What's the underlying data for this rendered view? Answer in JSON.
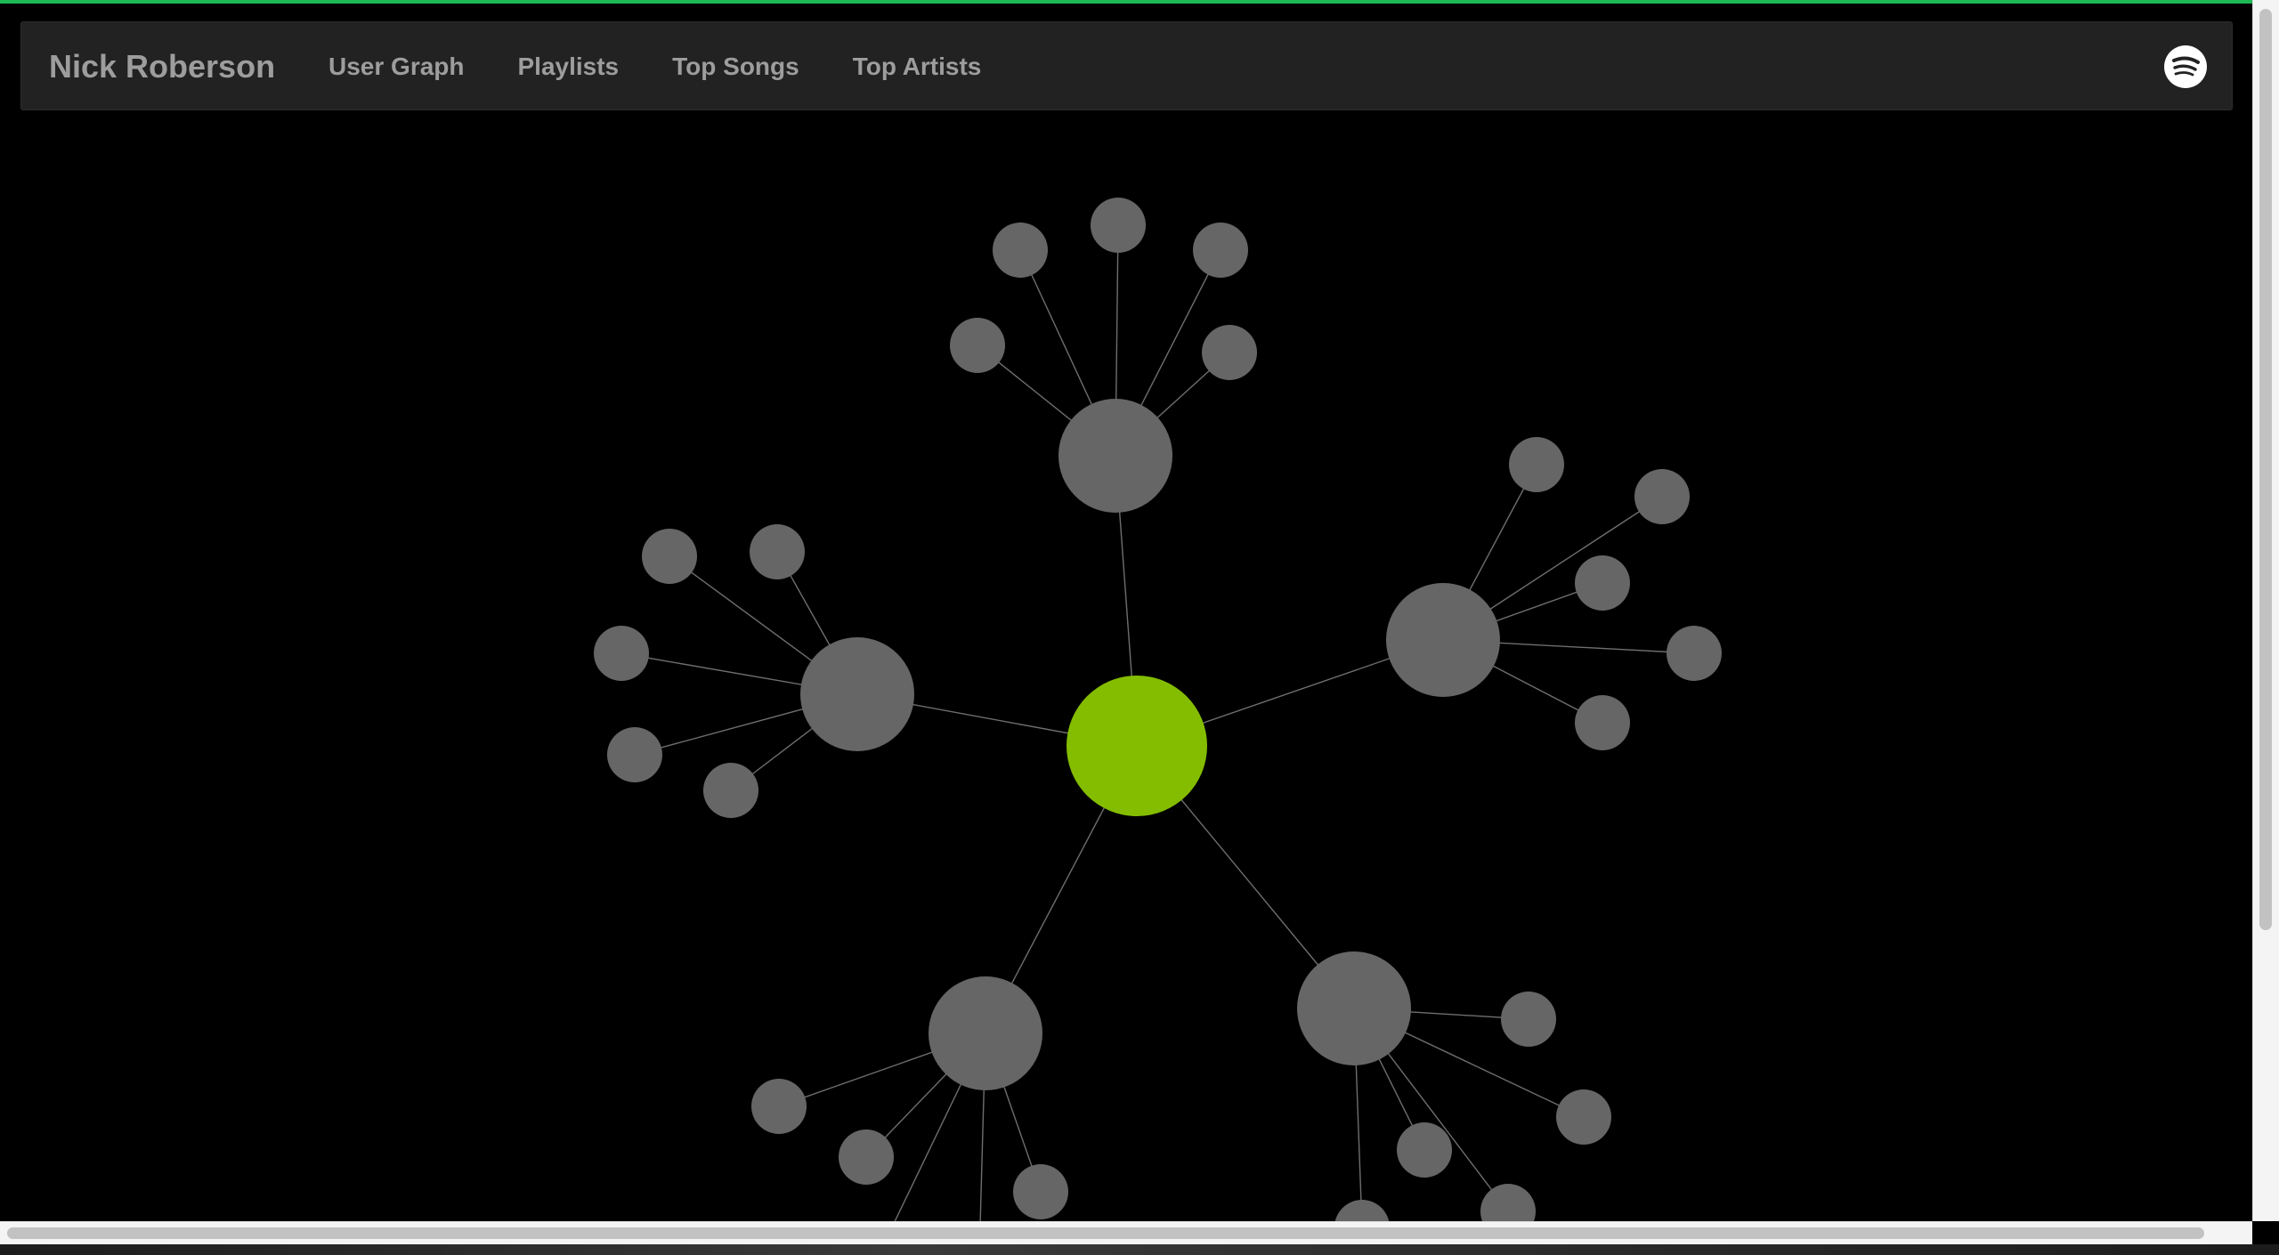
{
  "navbar": {
    "brand": "Nick Roberson",
    "links": [
      "User Graph",
      "Playlists",
      "Top Songs",
      "Top Artists"
    ],
    "icon": "spotify-icon"
  },
  "colors": {
    "accent": "#1db954",
    "user_node": "#84bd00",
    "node": "#666666",
    "edge": "#6e6e6e",
    "navbar_bg": "#222222",
    "nav_text": "#9d9d9d",
    "background": "#000000"
  },
  "graph": {
    "root": "user",
    "groups": [
      {
        "id": "hub-top",
        "leaf_count": 5
      },
      {
        "id": "hub-left",
        "leaf_count": 5
      },
      {
        "id": "hub-right",
        "leaf_count": 5
      },
      {
        "id": "hub-bottom-left",
        "leaf_count": 5
      },
      {
        "id": "hub-bottom-right",
        "leaf_count": 5
      }
    ]
  }
}
